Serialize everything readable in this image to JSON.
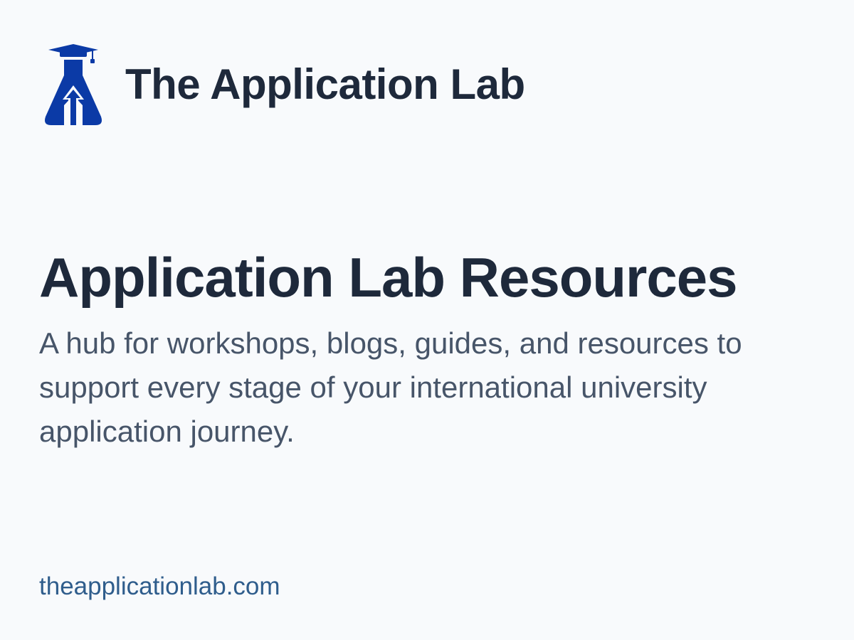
{
  "brand": {
    "name": "The Application Lab",
    "logo_icon": "flask-graduation-cap-arrow-icon",
    "logo_color": "#0b3aa6"
  },
  "hero": {
    "title": "Application Lab Resources",
    "subtitle": "A hub for workshops, blogs, guides, and resources to support every stage of your international university application journey."
  },
  "footer": {
    "link_text": "theapplicationlab.com"
  },
  "colors": {
    "background": "#f8fafc",
    "heading": "#1e293b",
    "body_text": "#475569",
    "link": "#2f5d8c"
  }
}
